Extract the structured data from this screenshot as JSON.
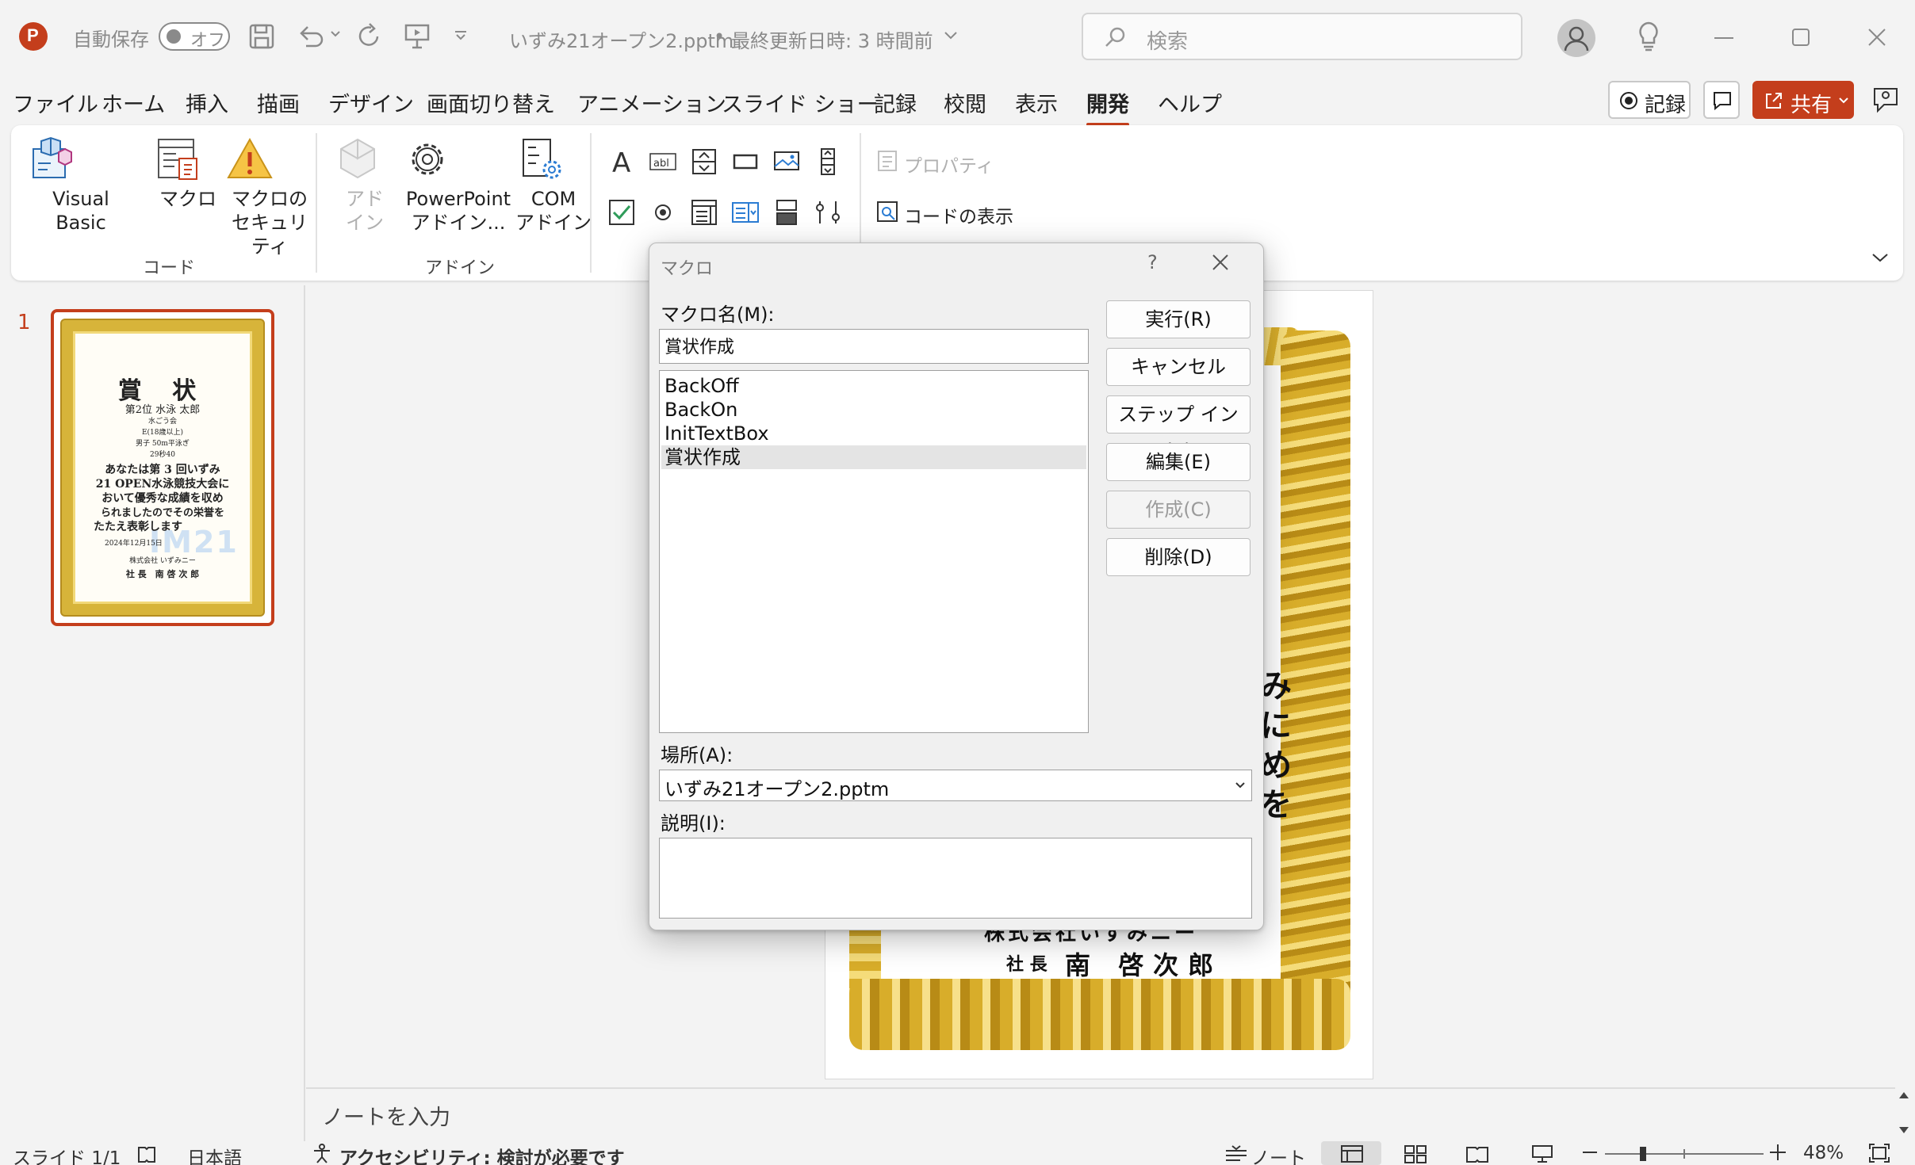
{
  "titlebar": {
    "autosave_label": "自動保存",
    "autosave_state": "オフ",
    "filename": "いずみ21オープン2.pptm",
    "separator": "•",
    "last_modified": "最終更新日時: 3 時間前",
    "search_placeholder": "検索"
  },
  "tabs": [
    "ファイル",
    "ホーム",
    "挿入",
    "描画",
    "デザイン",
    "画面切り替え",
    "アニメーション",
    "スライド ショー",
    "記録",
    "校閲",
    "表示",
    "開発",
    "ヘルプ"
  ],
  "active_tab": "開発",
  "top_buttons": {
    "record": "記録",
    "share": "共有"
  },
  "ribbon": {
    "visual_basic": "Visual Basic",
    "macro": "マクロ",
    "macro_security_line1": "マクロの",
    "macro_security_line2": "セキュリティ",
    "addin_line1": "アド",
    "addin_line2": "イン",
    "ppt_addin_line1": "PowerPoint",
    "ppt_addin_line2": "アドイン...",
    "com_addin_line1": "COM",
    "com_addin_line2": "アドイン",
    "group_code": "コード",
    "group_addin": "アドイン",
    "properties": "プロパティ",
    "view_code": "コードの表示"
  },
  "thumbnails": {
    "slide_number": "1",
    "title": "賞 状",
    "rank_line": "第2位 水泳 太郎",
    "club": "水ごう会",
    "category": "E(18歳以上)",
    "event": "男子 50m平泳ぎ",
    "time": "29秒40",
    "body1": "あなたは第 3 回いずみ",
    "body2": "21 OPEN水泳競技大会に",
    "body3": "おいて優秀な成績を収め",
    "body4": "られましたのでその栄誉を",
    "body5": "たたえ表彰します",
    "date": "2024年12月15日",
    "company": "株式会社 いずみニー",
    "president": "社 長　南 啓 次 郎",
    "watermark": "IM21"
  },
  "slide": {
    "vert_chars": [
      "み",
      "に",
      "め",
      "を"
    ],
    "company_partial": "株式会社いずみニー",
    "president_title": "社 長",
    "president_name": "南 啓次郎"
  },
  "notes_placeholder": "ノートを入力",
  "statusbar": {
    "slide_info": "スライド 1/1",
    "language": "日本語",
    "accessibility": "アクセシビリティ: 検討が必要です",
    "notes": "ノート",
    "zoom": "48%"
  },
  "dialog": {
    "title": "マクロ",
    "help": "?",
    "macro_name_label": "マクロ名(M):",
    "macro_name_value": "賞状作成",
    "macro_list": [
      "BackOff",
      "BackOn",
      "InitTextBox",
      "賞状作成"
    ],
    "selected_macro": "賞状作成",
    "location_label": "場所(A):",
    "location_value": "いずみ21オープン2.pptm",
    "description_label": "説明(I):",
    "description_value": "",
    "buttons": {
      "run": "実行(R)",
      "cancel": "キャンセル",
      "step_in": "ステップ イン(S)",
      "edit": "編集(E)",
      "create": "作成(C)",
      "delete": "削除(D)"
    }
  },
  "colors": {
    "accent": "#c43e1c",
    "gold": "#d7b43a"
  }
}
